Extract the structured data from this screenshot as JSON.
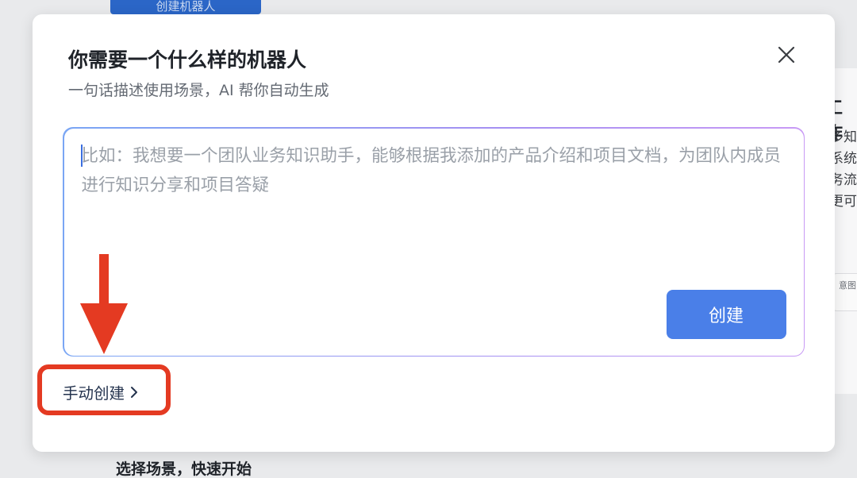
{
  "background": {
    "top_button_label": "创建机器人",
    "right_card_title": "工作",
    "right_card_lines": [
      "多知",
      "系统",
      "务流",
      "更可"
    ],
    "right_card_tag": "意图",
    "bottom_heading": "选择场景，快速开始"
  },
  "modal": {
    "title": "你需要一个什么样的机器人",
    "subtitle": "一句话描述使用场景，AI 帮你自动生成",
    "close_icon": "close-icon",
    "prompt": {
      "value": "",
      "placeholder": "比如：我想要一个团队业务知识助手，能够根据我添加的产品介绍和项目文档，为团队内成员进行知识分享和项目答疑"
    },
    "create_label": "创建",
    "manual_create_label": "手动创建",
    "manual_create_icon": "chevron-right-icon"
  },
  "annotation": {
    "arrow_icon": "arrow-down-icon",
    "color": "#e43a22"
  },
  "colors": {
    "primary": "#4a7fe8",
    "annotation_red": "#e43a22",
    "title": "#1f2329",
    "subtitle": "#646a73",
    "placeholder": "#9aa0a8"
  }
}
